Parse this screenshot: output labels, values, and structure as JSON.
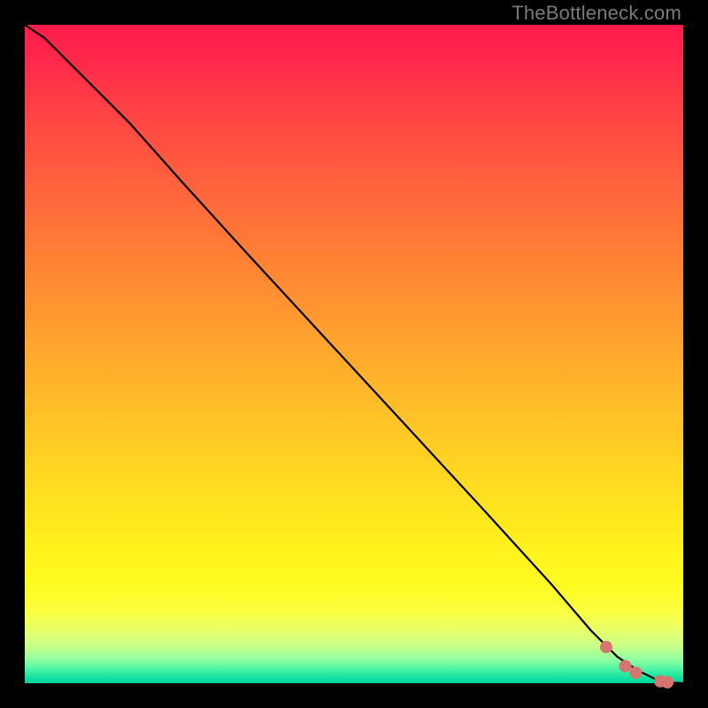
{
  "watermark": "TheBottleneck.com",
  "chart_data": {
    "type": "line",
    "title": "",
    "xlabel": "",
    "ylabel": "",
    "xlim": [
      0,
      100
    ],
    "ylim": [
      0,
      100
    ],
    "grid": false,
    "legend": false,
    "series": [
      {
        "name": "curve",
        "x": [
          0,
          3,
          6,
          10,
          16,
          24,
          34,
          46,
          58,
          70,
          80,
          86,
          90,
          93,
          96,
          98,
          100
        ],
        "y": [
          100,
          98,
          95,
          91,
          85,
          76,
          65,
          52,
          39,
          26,
          15,
          8,
          4,
          2,
          0.5,
          0.1,
          0
        ]
      }
    ],
    "markers": [
      {
        "type": "segment",
        "x0": 64,
        "y0": 35,
        "x1": 69,
        "y1": 29
      },
      {
        "type": "segment",
        "x0": 69.5,
        "y0": 28.4,
        "x1": 73.5,
        "y1": 24
      },
      {
        "type": "segment",
        "x0": 74,
        "y0": 23.2,
        "x1": 75.5,
        "y1": 21.5
      },
      {
        "type": "segment",
        "x0": 76,
        "y0": 21,
        "x1": 79,
        "y1": 17.5
      },
      {
        "type": "segment",
        "x0": 79.6,
        "y0": 16.6,
        "x1": 82.5,
        "y1": 13
      },
      {
        "type": "segment",
        "x0": 83,
        "y0": 12.2,
        "x1": 84.3,
        "y1": 10.7
      },
      {
        "type": "segment",
        "x0": 85,
        "y0": 9.7,
        "x1": 87.6,
        "y1": 6.4
      },
      {
        "type": "dot",
        "x": 88.3,
        "y": 5.5
      },
      {
        "type": "segment",
        "x0": 89,
        "y0": 4.5,
        "x1": 90.5,
        "y1": 3.2
      },
      {
        "type": "dot",
        "x": 91.2,
        "y": 2.6
      },
      {
        "type": "dot",
        "x": 92.8,
        "y": 1.6
      },
      {
        "type": "dot",
        "x": 96.5,
        "y": 0.3
      },
      {
        "type": "dot",
        "x": 97.6,
        "y": 0.15
      },
      {
        "type": "segment",
        "x0": 99,
        "y0": 0.05,
        "x1": 100,
        "y1": 0.02
      }
    ],
    "colors": {
      "marker": "#d6746e",
      "line": "#000000"
    }
  }
}
